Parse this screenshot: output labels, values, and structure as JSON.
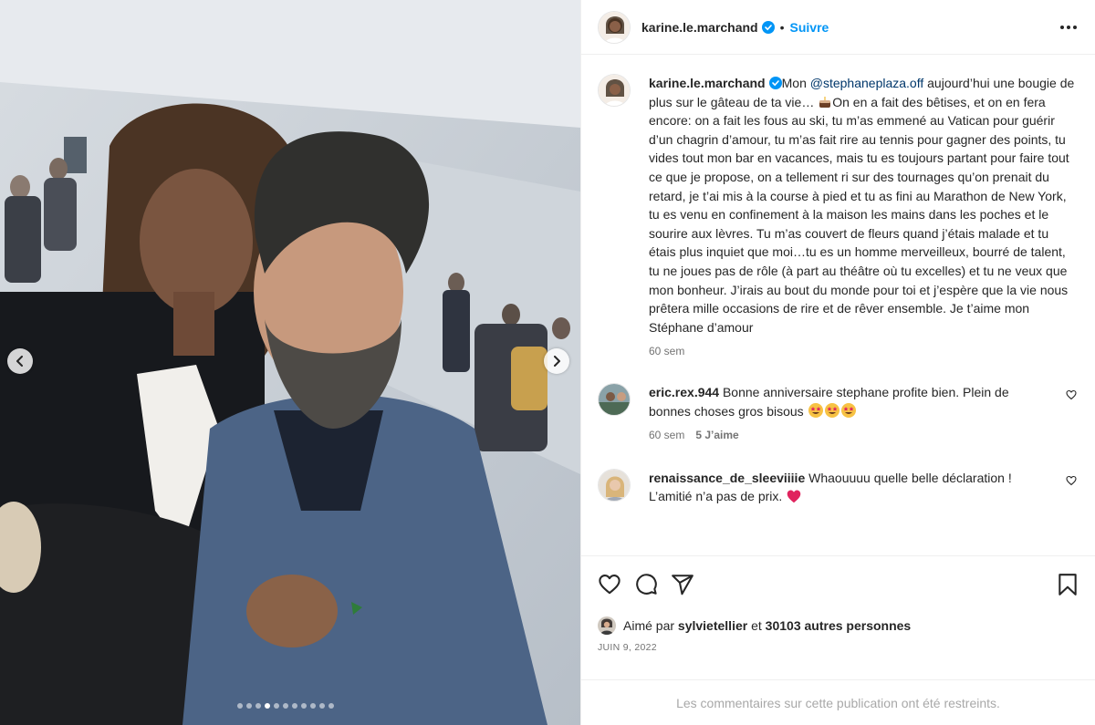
{
  "post": {
    "author": "karine.le.marchand",
    "follow_label": "Suivre",
    "separator": "•",
    "caption_mention": "@stephaneplaza.off",
    "caption_before": "Mon ",
    "caption_part1": " aujourd’hui une bougie de plus sur le gâteau de ta vie… ",
    "caption_part2": "On en a fait des bêtises, et on en fera encore: on a fait les fous au ski, tu m’as emmené au Vatican pour guérir d’un chagrin d’amour, tu m’as fait rire au tennis pour gagner des points, tu vides tout mon bar en vacances, mais tu es toujours partant pour faire tout ce que je propose, on a tellement ri sur des tournages qu’on prenait du retard, je t’ai mis à la course à pied et tu as fini au Marathon de New York, tu es venu en confinement à la maison les mains dans les poches et le sourire aux lèvres. Tu m’as couvert de fleurs quand j’étais malade et tu étais plus inquiet que moi…tu es un homme merveilleux, bourré de talent, tu ne joues pas de rôle (à part au théâtre où tu excelles) et tu ne veux que mon bonheur. J’irais au bout du monde pour toi et j’espère que la vie nous prêtera mille occasions de rire et de rêver ensemble. Je t’aime mon Stéphane d’amour",
    "caption_time": "60 sem",
    "carousel_active": 3,
    "carousel_count": 11
  },
  "comments": [
    {
      "user": "eric.rex.944",
      "text": "Bonne anniversaire stephane profite bien. Plein de bonnes choses gros bisous ",
      "time": "60 sem",
      "likes": "5 J’aime"
    },
    {
      "user": "renaissance_de_sleeviiiie",
      "text": "Whaouuuu quelle belle déclaration ! L’amitié n’a pas de prix. "
    }
  ],
  "likes": {
    "prefix": "Aimé par ",
    "user": "sylvietellier",
    "middle": " et ",
    "count": "30103 autres personnes"
  },
  "date": "JUIN 9, 2022",
  "restricted": "Les commentaires sur cette publication ont été restreints.",
  "icons": [
    "chevron-left-icon",
    "chevron-right-icon",
    "verified-icon",
    "more-icon",
    "heart-icon",
    "comment-icon",
    "share-icon",
    "save-icon"
  ],
  "colors": {
    "link": "#0095f6",
    "mention": "#00376b",
    "meta": "#737373",
    "border": "#efefef"
  }
}
